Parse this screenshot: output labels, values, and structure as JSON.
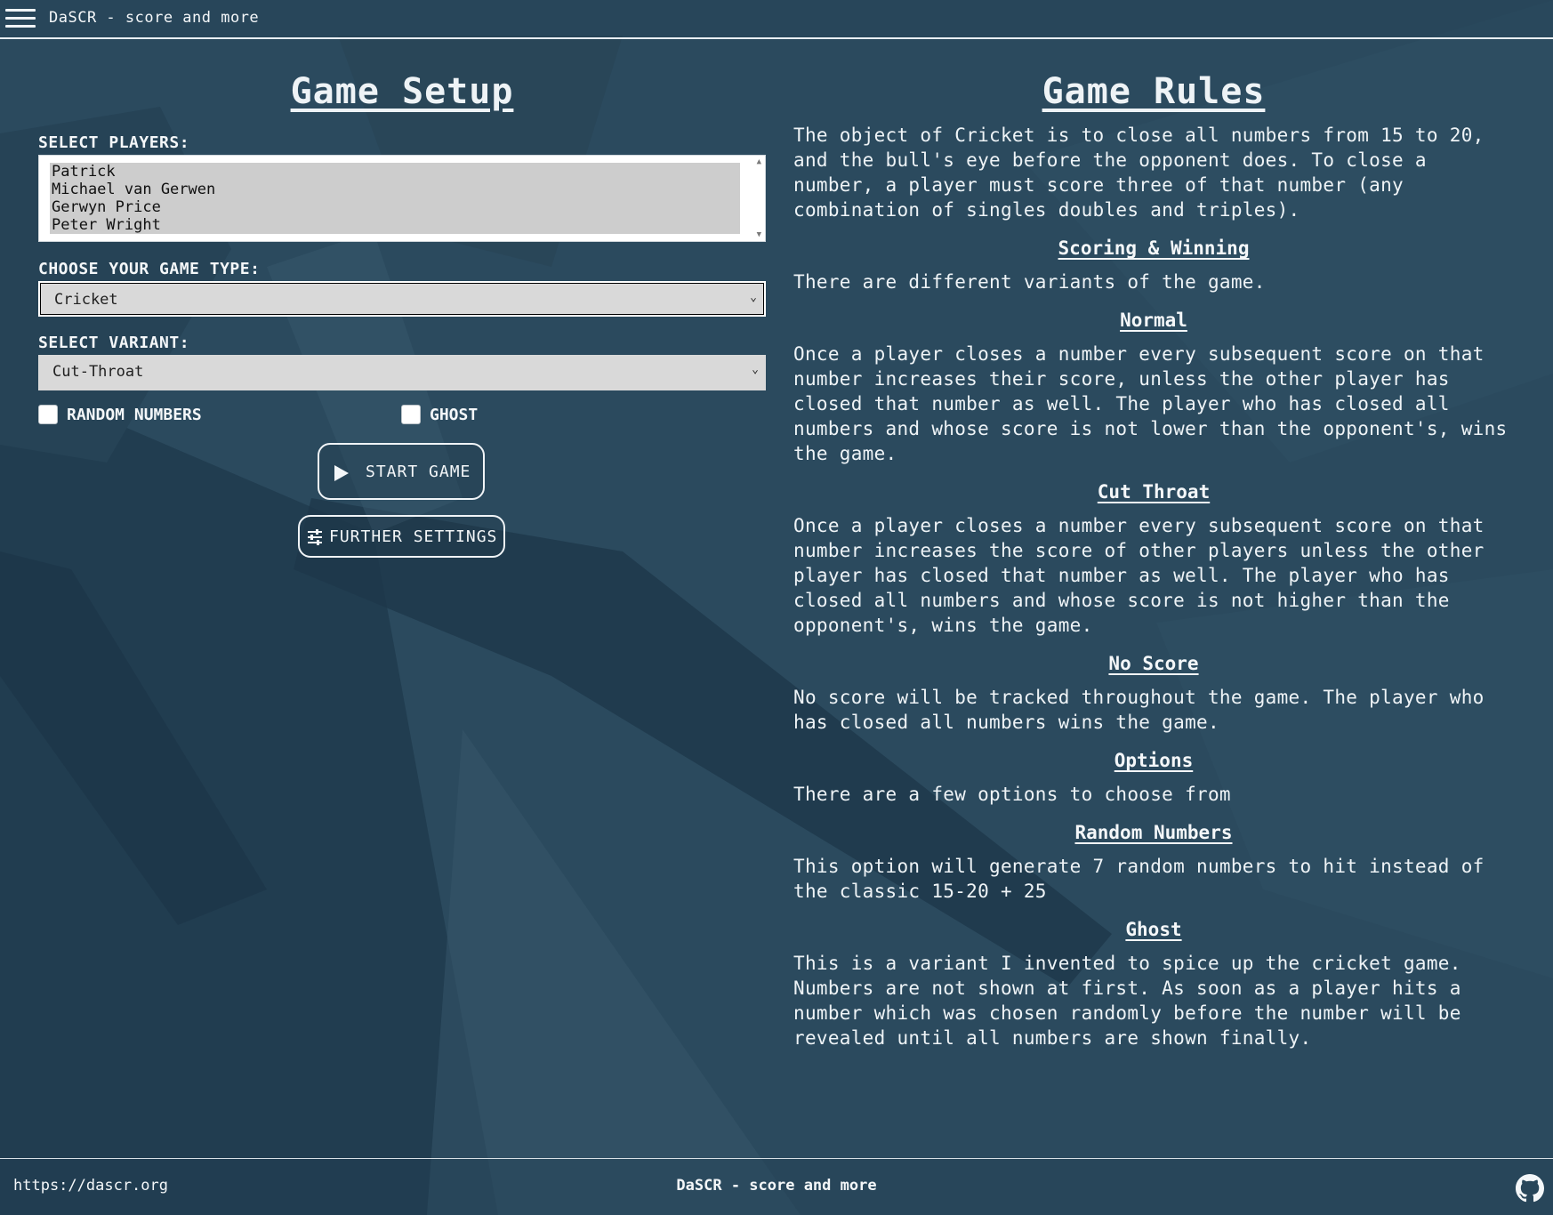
{
  "header": {
    "title": "DaSCR - score and more",
    "menu_icon": "hamburger-menu-icon"
  },
  "setup": {
    "heading": "Game Setup",
    "players_label": "SELECT PLAYERS:",
    "players": [
      "Patrick",
      "Michael van Gerwen",
      "Gerwyn Price",
      "Peter Wright"
    ],
    "game_type_label": "CHOOSE YOUR GAME TYPE:",
    "game_type_value": "Cricket",
    "variant_label": "SELECT VARIANT:",
    "variant_value": "Cut-Throat",
    "random_numbers_label": "RANDOM NUMBERS",
    "random_numbers_checked": false,
    "ghost_label": "GHOST",
    "ghost_checked": false,
    "start_label": "START GAME",
    "start_icon": "play-icon",
    "settings_label": "FURTHER SETTINGS",
    "settings_icon": "sliders-icon"
  },
  "rules": {
    "heading": "Game Rules",
    "intro": "The object of Cricket is to close all numbers from 15 to 20, and the bull's eye before the opponent does. To close a number, a player must score three of that number (any combination of singles doubles and triples).",
    "scoring_heading": "Scoring & Winning",
    "scoring_text": "There are different variants of the game.",
    "normal_heading": "Normal",
    "normal_text": "Once a player closes a number every subsequent score on that number increases their score, unless the other player has closed that number as well. The player who has closed all numbers and whose score is not lower than the opponent's, wins the game.",
    "cutthroat_heading": "Cut Throat",
    "cutthroat_text": "Once a player closes a number every subsequent score on that number increases the score of other players unless the other player has closed that number as well. The player who has closed all numbers and whose score is not higher than the opponent's, wins the game.",
    "noscore_heading": "No Score",
    "noscore_text": "No score will be tracked throughout the game. The player who has closed all numbers wins the game.",
    "options_heading": "Options",
    "options_text": "There are a few options to choose from",
    "random_heading": "Random Numbers",
    "random_text": "This option will generate 7 random numbers to hit instead of the classic 15-20 + 25",
    "ghost_heading": "Ghost",
    "ghost_text": "This is a variant I invented to spice up the cricket game. Numbers are not shown at first. As soon as a player hits a number which was chosen randomly before the number will be revealed until all numbers are shown finally."
  },
  "footer": {
    "link": "https://dascr.org",
    "title": "DaSCR - score and more",
    "github_icon": "github-icon"
  },
  "colors": {
    "background": "#2a475b",
    "dark_shape": "#1f3a4d",
    "text": "#eef3f6",
    "select_bg": "#d9d9d9"
  }
}
